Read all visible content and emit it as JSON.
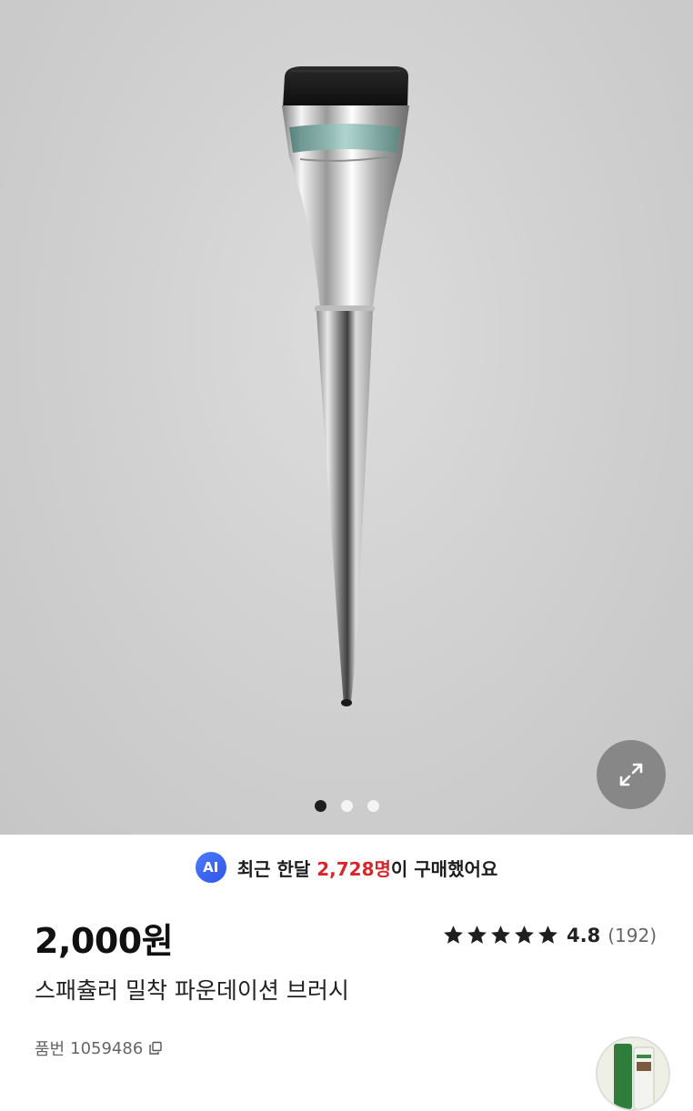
{
  "gallery": {
    "image_alt": "스패츌러 밀착 파운데이션 브러시",
    "expand_icon": "expand-arrows-icon",
    "dots": [
      {
        "active": true
      },
      {
        "active": false
      },
      {
        "active": false
      }
    ]
  },
  "purchase_banner": {
    "badge": "AI",
    "prefix": "최근 한달 ",
    "count": "2,728명",
    "suffix": "이 구매했어요",
    "count_color": "#d7262c"
  },
  "product": {
    "price": "2,000원",
    "title": "스패츌러 밀착 파운데이션 브러시",
    "sku_label": "품번",
    "sku_value": "1059486"
  },
  "rating": {
    "stars_value": 4.8,
    "score": "4.8",
    "count": "(192)"
  },
  "colors": {
    "accent_red": "#d7262c",
    "ai_blue": "#3a63f0"
  }
}
